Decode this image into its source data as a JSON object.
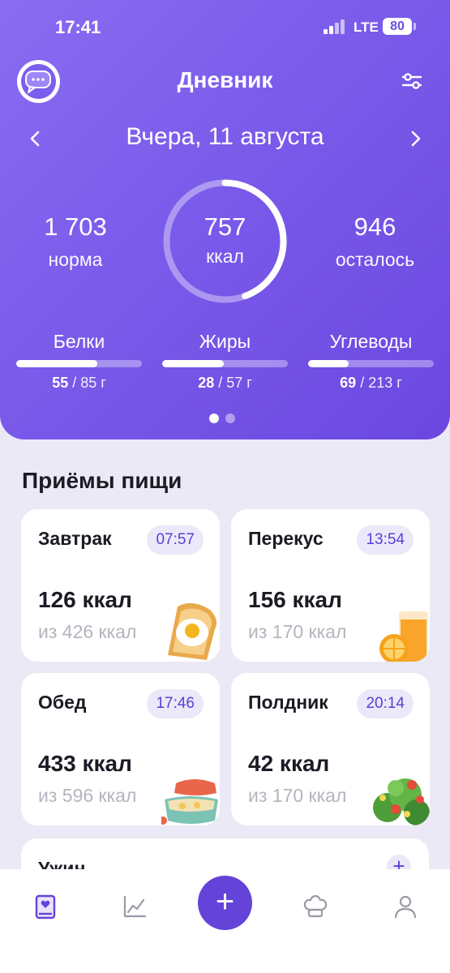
{
  "status": {
    "time": "17:41",
    "network": "LTE",
    "battery": "80"
  },
  "header": {
    "title": "Дневник",
    "date": "Вчера,  11 августа"
  },
  "summary": {
    "norm_value": "1 703",
    "norm_label": "норма",
    "eaten_value": "757",
    "eaten_unit": "ккал",
    "left_value": "946",
    "left_label": "осталось",
    "progress": 0.444
  },
  "macros": [
    {
      "name": "Белки",
      "eaten": "55",
      "total": " / 85 г",
      "progress": 0.647
    },
    {
      "name": "Жиры",
      "eaten": "28",
      "total": " / 57 г",
      "progress": 0.491
    },
    {
      "name": "Углеводы",
      "eaten": "69",
      "total": " / 213 г",
      "progress": 0.324
    }
  ],
  "meals_title": "Приёмы пищи",
  "meals": [
    {
      "name": "Завтрак",
      "time": "07:57",
      "kcal": "126 ккал",
      "target": "из 426 ккал",
      "image": "toast-egg-icon"
    },
    {
      "name": "Перекус",
      "time": "13:54",
      "kcal": "156 ккал",
      "target": "из 170 ккал",
      "image": "orange-juice-icon"
    },
    {
      "name": "Обед",
      "time": "17:46",
      "kcal": "433 ккал",
      "target": "из 596 ккал",
      "image": "lunchbox-icon"
    },
    {
      "name": "Полдник",
      "time": "20:14",
      "kcal": "42 ккал",
      "target": "из 170 ккал",
      "image": "salad-icon"
    }
  ],
  "dinner": {
    "name": "Ужин",
    "add": "+"
  },
  "tabbar": {
    "fab": "+"
  },
  "colors": {
    "accent": "#6443D8",
    "header": "#7A5BEA",
    "pill_bg": "#ECE8FA"
  }
}
